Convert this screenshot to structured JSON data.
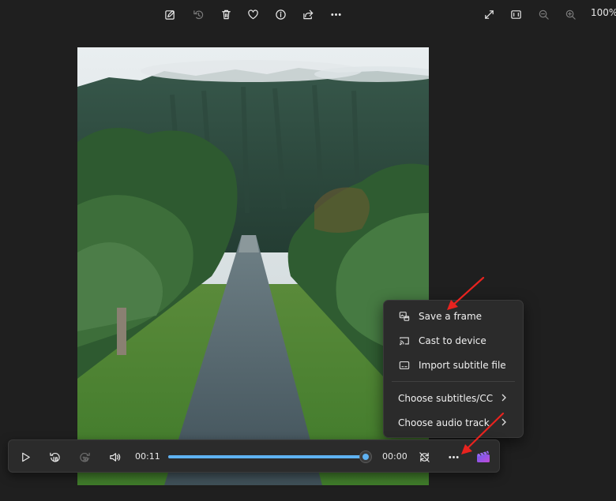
{
  "toolbar": {
    "left_icons": [
      "edit-image-icon",
      "rotate-icon",
      "delete-icon",
      "favorite-icon",
      "info-icon",
      "share-icon",
      "more-icon"
    ],
    "right_icons": [
      "full-screen-icon",
      "fit-to-window-icon",
      "zoom-out-icon",
      "zoom-in-icon"
    ],
    "zoom_level": "100%"
  },
  "menu": {
    "items": [
      {
        "label": "Save a frame",
        "icon": "save-frame-icon"
      },
      {
        "label": "Cast to device",
        "icon": "cast-icon"
      },
      {
        "label": "Import subtitle file",
        "icon": "subtitle-file-icon"
      }
    ],
    "submenus": [
      {
        "label": "Choose subtitles/CC"
      },
      {
        "label": "Choose audio track"
      }
    ]
  },
  "player": {
    "elapsed": "00:11",
    "remaining": "00:00",
    "progress_percent": 100,
    "accent_color": "#5fb2f2"
  },
  "annotation": {
    "arrow_color": "#e8231f"
  }
}
